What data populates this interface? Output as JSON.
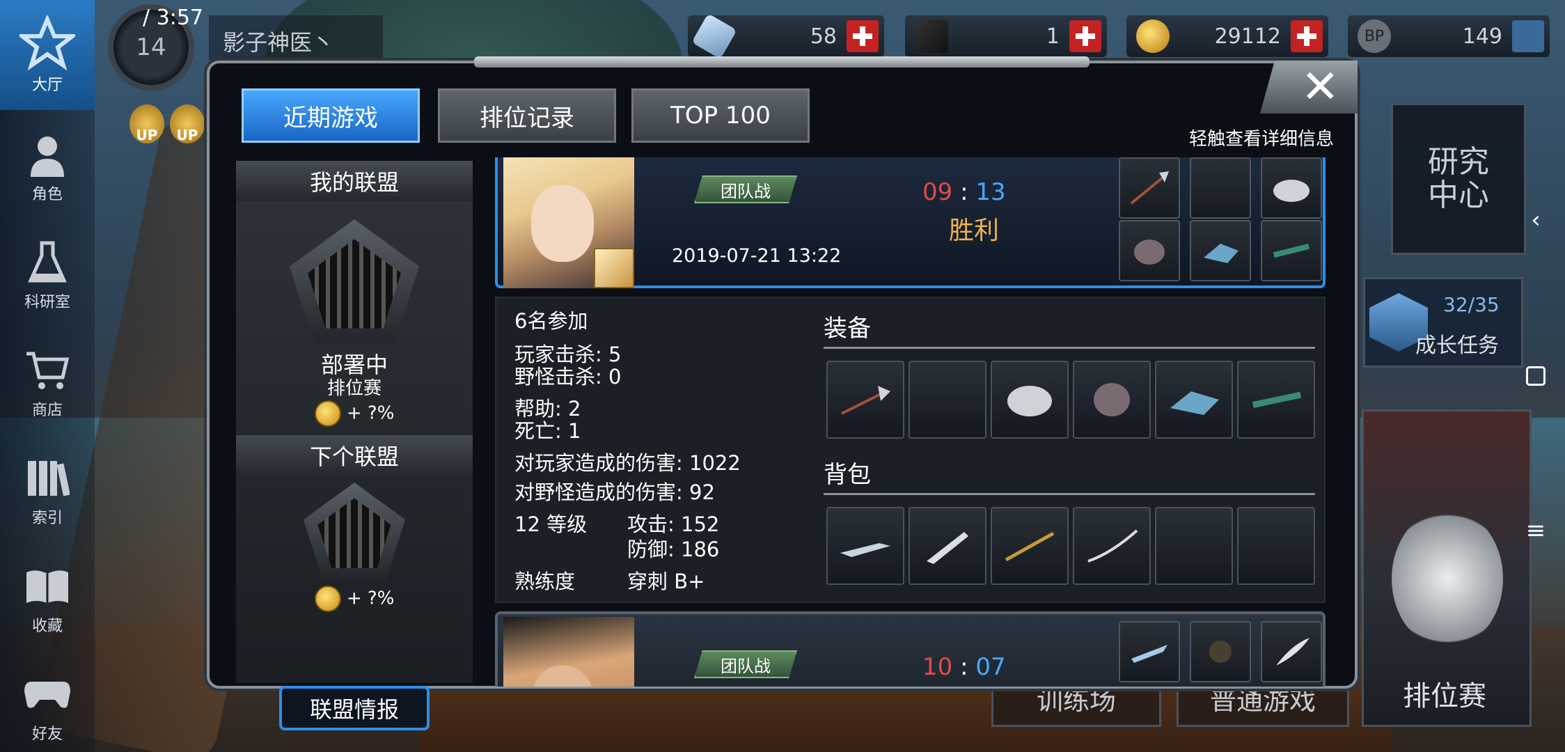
{
  "status": {
    "time": "/ 3:57",
    "level": "14",
    "player_name": "影子神医丶"
  },
  "resources": [
    {
      "name": "crystal",
      "value": "58"
    },
    {
      "name": "ticket",
      "value": "1"
    },
    {
      "name": "gold",
      "value": "29112"
    },
    {
      "name": "bp",
      "label": "BP",
      "value": "149"
    }
  ],
  "up_labels": [
    "UP",
    "UP"
  ],
  "nav": [
    {
      "label": "大厅",
      "icon": "lobby-star-icon"
    },
    {
      "label": "角色",
      "icon": "character-icon"
    },
    {
      "label": "科研室",
      "icon": "flask-icon"
    },
    {
      "label": "商店",
      "icon": "cart-icon"
    },
    {
      "label": "索引",
      "icon": "books-icon"
    },
    {
      "label": "收藏",
      "icon": "open-book-icon"
    },
    {
      "label": "好友",
      "icon": "gamepad-icon"
    }
  ],
  "right": {
    "research": "研究\n中心",
    "growth_progress": "32/35",
    "growth_label": "成长任务",
    "training": "训练场",
    "normal_game": "普通游戏",
    "ranked": "排位赛"
  },
  "modal": {
    "tabs": [
      {
        "label": "近期游戏",
        "active": true
      },
      {
        "label": "排位记录",
        "active": false
      },
      {
        "label": "TOP 100",
        "active": false
      }
    ],
    "hint": "轻触查看详细信息",
    "close": "✕"
  },
  "alliance": {
    "my_title": "我的联盟",
    "status": "部署中",
    "type": "排位赛",
    "bonus1": "+ ?%",
    "next_title": "下个联盟",
    "bonus2": "+ ?%",
    "button": "联盟情报"
  },
  "matches": [
    {
      "mode": "团队战",
      "date": "2019-07-21 13:22",
      "score_red": "09",
      "score_sep": ":",
      "score_blue": "13",
      "result": "胜利",
      "items": [
        "spear",
        "empty",
        "disc",
        "armor",
        "gauntlet",
        "rifle"
      ]
    },
    {
      "mode": "团队战",
      "score_red": "10",
      "score_sep": ":",
      "score_blue": "07",
      "items": [
        "blades",
        "helmet",
        "feather"
      ]
    }
  ],
  "details": {
    "participants": "6名参加",
    "player_kills": "玩家击杀: 5",
    "monster_kills": "野怪击杀: 0",
    "assists": "帮助: 2",
    "deaths": "死亡: 1",
    "player_damage": "对玩家造成的伤害: 1022",
    "monster_damage": "对野怪造成的伤害: 92",
    "level": "12 等级",
    "attack": "攻击: 152",
    "defense": "防御: 186",
    "proficiency_label": "熟练度",
    "proficiency_value": "穿刺 B+",
    "equipment_title": "装备",
    "bag_title": "背包",
    "equipment": [
      "spear",
      "empty",
      "disc",
      "armor",
      "gauntlet",
      "rifle"
    ],
    "bag": [
      "blade",
      "knife",
      "staff",
      "katana",
      "empty",
      "empty"
    ]
  },
  "colors": {
    "accent": "#2d8ee8",
    "win": "#f0b24a",
    "red_team": "#e14a4a",
    "blue_team": "#4aa8ff"
  }
}
